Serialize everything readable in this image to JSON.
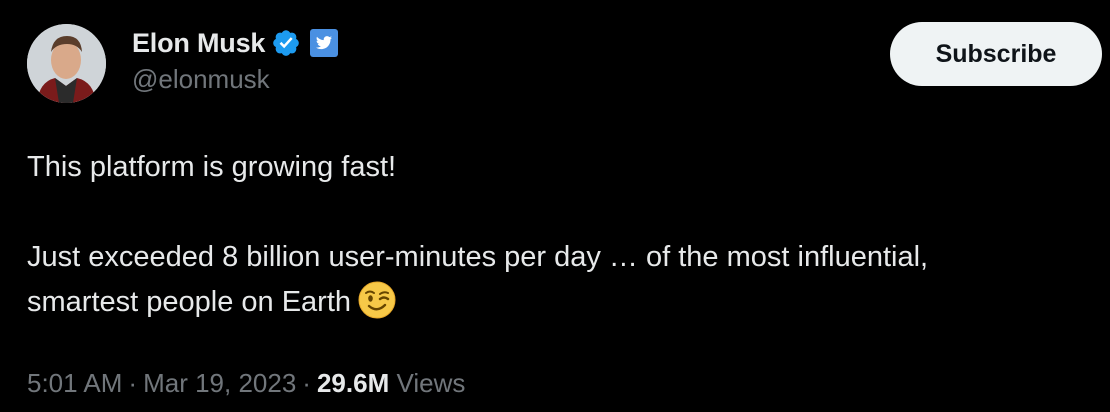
{
  "author": {
    "display_name": "Elon Musk",
    "handle": "@elonmusk",
    "avatar_icon": "profile-photo",
    "verified_icon": "verified-badge-icon",
    "affiliate_icon": "twitter-bird-badge-icon",
    "verified_color": "#1d9bf0"
  },
  "actions": {
    "subscribe_label": "Subscribe"
  },
  "tweet": {
    "line1": "This platform is growing fast!",
    "line2": "Just exceeded 8 billion user-minutes per day … of the most influential,",
    "line3": "smartest people on Earth",
    "emoji": "winking-face-emoji"
  },
  "meta": {
    "time": "5:01 AM",
    "separator": "·",
    "date": "Mar 19, 2023",
    "views_count": "29.6M",
    "views_label": "Views"
  },
  "colors": {
    "background": "#000000",
    "primary_text": "#e7e9ea",
    "secondary_text": "#71767b",
    "button_bg": "#eff3f4"
  }
}
